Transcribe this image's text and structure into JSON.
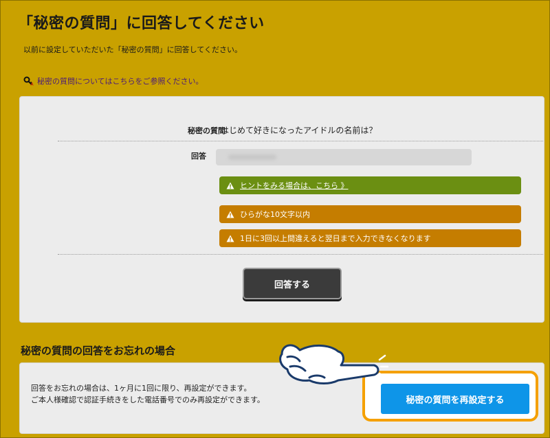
{
  "page": {
    "title": "「秘密の質問」に回答してください",
    "subtitle": "以前に設定していただいた「秘密の質問」に回答してください。",
    "help_link": "秘密の質問についてはこちらをご参照ください。"
  },
  "qa": {
    "question_label": "秘密の質問",
    "question_text": "はじめて好きになったアイドルの名前は？",
    "answer_label": "回答",
    "answer_value": ""
  },
  "notices": {
    "hint_link": "ヒントをみる場合は、こちら 》",
    "rule_chars": "ひらがな10文字以内",
    "rule_attempts": "1日に3回以上間違えると翌日まで入力できなくなります"
  },
  "actions": {
    "answer_button": "回答する",
    "reset_button": "秘密の質問を再設定する"
  },
  "forgot": {
    "heading": "秘密の質問の回答をお忘れの場合",
    "line1": "回答をお忘れの場合は、1ヶ月に1回に限り、再設定ができます。",
    "line2": "ご本人様確認で認証手続きをした電話番号でのみ再設定ができます。"
  },
  "colors": {
    "background": "#c9a100",
    "hint_green": "#6b8f12",
    "warning_orange": "#c57d00",
    "reset_blue": "#0e95e8",
    "highlight_orange": "#f5a000"
  },
  "icons": [
    "key-icon",
    "warning-icon",
    "pointing-hand-icon"
  ]
}
